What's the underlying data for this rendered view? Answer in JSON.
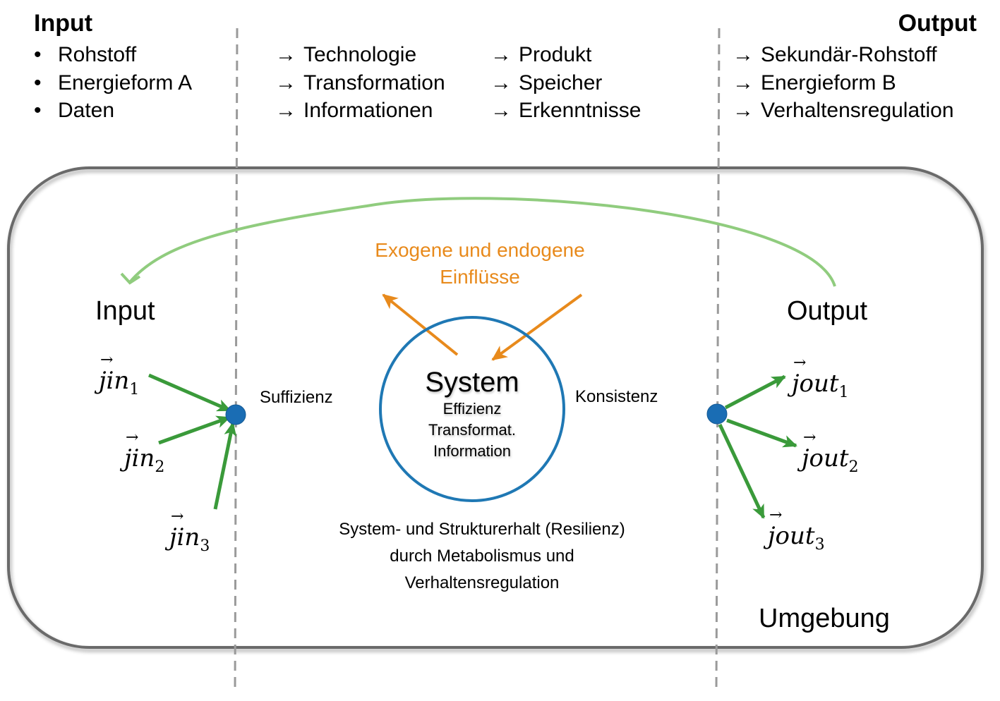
{
  "header": {
    "input_title": "Input",
    "input_items": [
      "Rohstoff",
      "Energieform A",
      "Daten"
    ],
    "bullet_symbol": "•",
    "arrow_symbol": "→",
    "middle_col1": [
      "Technologie",
      "Transformation",
      "Informationen"
    ],
    "middle_col2": [
      "Produkt",
      "Speicher",
      "Erkenntnisse"
    ],
    "output_title": "Output",
    "output_items": [
      "Sekundär-Rohstoff",
      "Energieform B",
      "Verhaltensregulation"
    ]
  },
  "diagram": {
    "input_label": "Input",
    "output_label": "Output",
    "influences_line1": "Exogene und endogene",
    "influences_line2": "Einflüsse",
    "system_title": "System",
    "system_lines": [
      "Effizienz",
      "Transformat.",
      "Information"
    ],
    "flow_in_label": "Suffizienz",
    "flow_out_label": "Konsistenz",
    "resilience_lines": [
      "System- und Strukturerhalt (Resilienz)",
      "durch Metabolismus und",
      "Verhaltensregulation"
    ],
    "environment_label": "Umgebung",
    "input_fluxes": [
      {
        "symbol": "j",
        "sub": "in",
        "index": "1"
      },
      {
        "symbol": "j",
        "sub": "in",
        "index": "2"
      },
      {
        "symbol": "j",
        "sub": "in",
        "index": "3"
      }
    ],
    "output_fluxes": [
      {
        "symbol": "j",
        "sub": "out",
        "index": "1"
      },
      {
        "symbol": "j",
        "sub": "out",
        "index": "2"
      },
      {
        "symbol": "j",
        "sub": "out",
        "index": "3"
      }
    ]
  },
  "colors": {
    "flow_blue": "#1f78b4",
    "flux_green": "#3a9a3a",
    "feedback_green": "#90cc7e",
    "influence_orange": "#e88a1c",
    "frame_gray": "#6a6a6a",
    "divider_gray": "#9a9a9a"
  }
}
